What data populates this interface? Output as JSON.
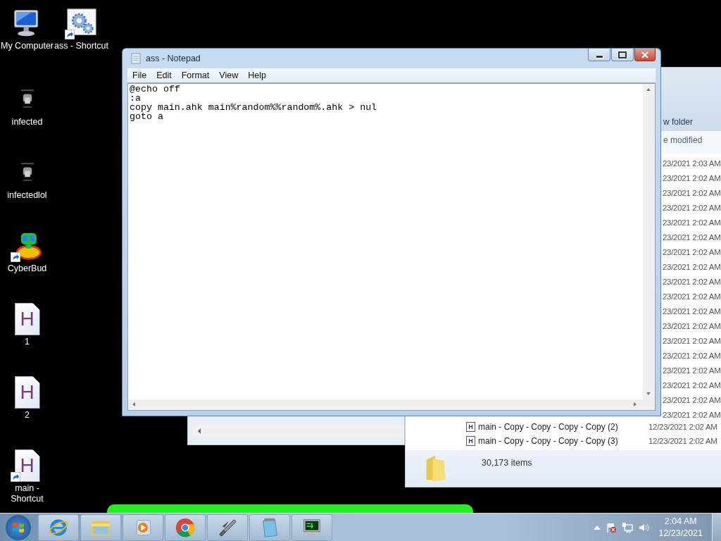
{
  "desktop_icons": [
    {
      "label": "My Computer",
      "kind": "computer",
      "shortcut": false
    },
    {
      "label": "ass - Shortcut",
      "kind": "gears",
      "shortcut": true
    },
    {
      "label": "infected",
      "kind": "thumbnail",
      "shortcut": false
    },
    {
      "label": "infectedlol",
      "kind": "thumbnail",
      "shortcut": false
    },
    {
      "label": "CyberBud",
      "kind": "buddy",
      "shortcut": true
    },
    {
      "label": "1",
      "kind": "script",
      "glyph": "H",
      "shortcut": false
    },
    {
      "label": "2",
      "kind": "script",
      "glyph": "H",
      "shortcut": false
    },
    {
      "label": "main - Shortcut",
      "kind": "script",
      "glyph": "H",
      "shortcut": true
    }
  ],
  "back_window": {
    "kind": "scrollbar"
  },
  "explorer": {
    "toolbar_text": "w folder",
    "column_header": "e modified",
    "date_fragments": [
      "23/2021 2:03 AM",
      "23/2021 2:02 AM",
      "23/2021 2:02 AM",
      "23/2021 2:02 AM",
      "23/2021 2:02 AM",
      "23/2021 2:02 AM",
      "23/2021 2:02 AM",
      "23/2021 2:02 AM",
      "23/2021 2:02 AM",
      "23/2021 2:02 AM",
      "23/2021 2:02 AM",
      "23/2021 2:02 AM",
      "23/2021 2:02 AM",
      "23/2021 2:02 AM",
      "23/2021 2:02 AM",
      "23/2021 2:02 AM",
      "23/2021 2:02 AM",
      "23/2021 2:02 AM"
    ],
    "rows": [
      {
        "glyph": "H",
        "name": "main - Copy - Copy - Copy - Copy (2)",
        "date": "12/23/2021 2:02 AM"
      },
      {
        "glyph": "H",
        "name": "main - Copy - Copy - Copy - Copy (3)",
        "date": "12/23/2021 2:02 AM"
      }
    ],
    "status": "30,173 items"
  },
  "notepad": {
    "title": "ass - Notepad",
    "menu": [
      "File",
      "Edit",
      "Format",
      "View",
      "Help"
    ],
    "lines": [
      "@echo off",
      ":a",
      "copy main.ahk main%random%%random%.ahk > nul",
      "goto a"
    ]
  },
  "taskbar": {
    "items": [
      {
        "kind": "ie"
      },
      {
        "kind": "explorer"
      },
      {
        "kind": "media"
      },
      {
        "kind": "chrome"
      },
      {
        "kind": "rocket"
      },
      {
        "kind": "notepad"
      },
      {
        "kind": "terminal"
      }
    ],
    "time": "2:04 AM",
    "date": "12/23/2021"
  }
}
